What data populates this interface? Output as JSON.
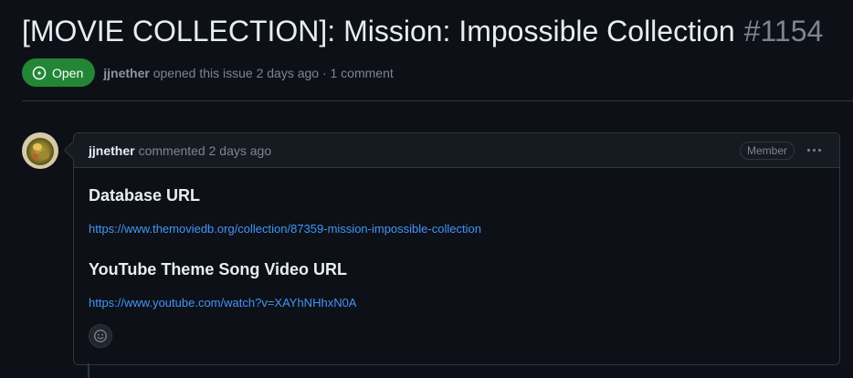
{
  "issue": {
    "title": "[MOVIE COLLECTION]: Mission: Impossible Collection",
    "number": "#1154",
    "state_label": "Open",
    "author": "jjnether",
    "meta_action": "opened this issue 2 days ago · 1 comment"
  },
  "comment": {
    "author": "jjnether",
    "action": "commented 2 days ago",
    "role_badge": "Member",
    "sections": [
      {
        "heading": "Database URL",
        "link": "https://www.themoviedb.org/collection/87359-mission-impossible-collection"
      },
      {
        "heading": "YouTube Theme Song Video URL",
        "link": "https://www.youtube.com/watch?v=XAYhNHhxN0A"
      }
    ]
  },
  "icons": {
    "state": "issue-opened-icon",
    "menu": "kebab-horizontal-icon",
    "reaction": "smiley-icon"
  },
  "colors": {
    "background": "#0d1117",
    "open_badge": "#238636",
    "link": "#4493f8",
    "muted": "#7d8590",
    "border": "#30363d"
  }
}
